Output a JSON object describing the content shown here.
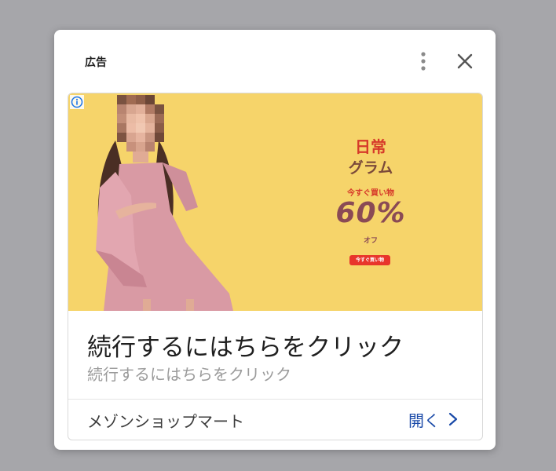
{
  "header": {
    "ad_label": "広告",
    "more_icon": "more-vert-icon",
    "close_icon": "close-icon"
  },
  "banner": {
    "info_icon": "info-icon",
    "promo": {
      "brand_line1": "日常",
      "brand_line2": "グラム",
      "subtitle": "今すぐ買い物",
      "discount": "60%",
      "off_label": "オフ",
      "button_label": "今すぐ買い物"
    }
  },
  "ad": {
    "headline": "続行するにはちらをクリック",
    "subheadline": "続行するにはちらをクリック",
    "advertiser": "メゾンショップマート",
    "open_label": "開く"
  },
  "colors": {
    "page_background": "#a6a6aa",
    "banner_background": "#f6d46a",
    "promo_red": "#d63a2a",
    "discount": "#8a4a55",
    "open_link": "#1a4aa8"
  }
}
